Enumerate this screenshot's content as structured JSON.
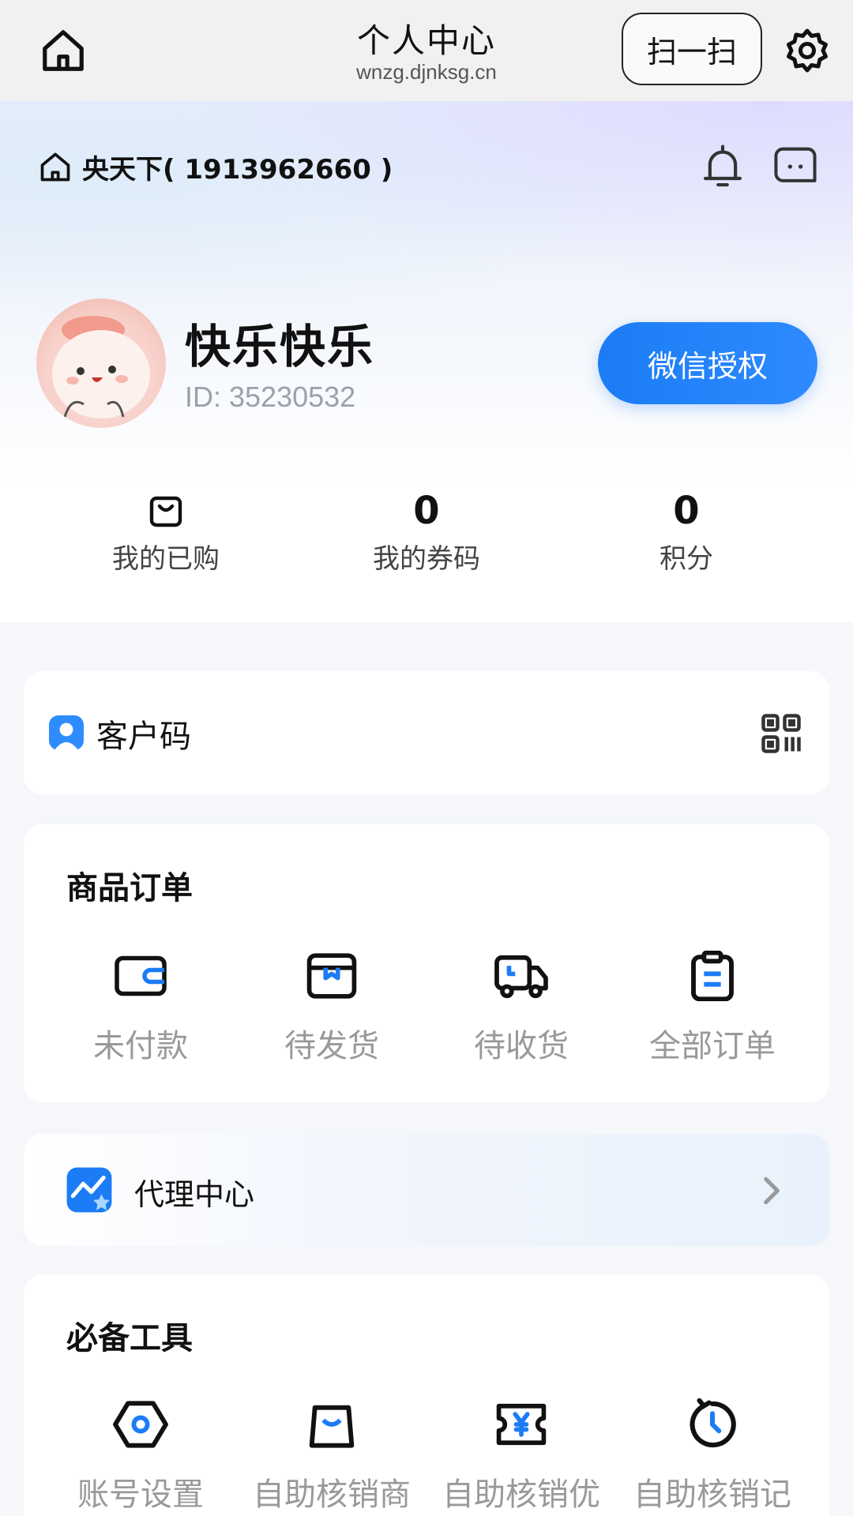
{
  "browser": {
    "title": "个人中心",
    "url": "wnzg.djnksg.cn",
    "scan_label": "扫一扫"
  },
  "header": {
    "store_name": "央天下( 1913962660 )"
  },
  "profile": {
    "name": "快乐快乐",
    "id_text": "ID: 35230532",
    "wechat_button": "微信授权"
  },
  "stats": [
    {
      "label": "我的已购",
      "icon": "shopping-bag-icon"
    },
    {
      "value": "0",
      "label": "我的券码"
    },
    {
      "value": "0",
      "label": "积分"
    }
  ],
  "customer_code": {
    "label": "客户码",
    "icon": "user-badge-icon",
    "action_icon": "qr-code-icon"
  },
  "orders": {
    "title": "商品订单",
    "items": [
      {
        "label": "未付款",
        "icon": "wallet-icon"
      },
      {
        "label": "待发货",
        "icon": "box-icon"
      },
      {
        "label": "待收货",
        "icon": "truck-icon"
      },
      {
        "label": "全部订单",
        "icon": "clipboard-icon"
      }
    ]
  },
  "agent": {
    "label": "代理中心",
    "icon": "chart-star-icon"
  },
  "tools": {
    "title": "必备工具",
    "items": [
      {
        "label": "账号设置",
        "icon": "hexagon-settings-icon"
      },
      {
        "label": "自助核销商",
        "icon": "bag-smile-icon"
      },
      {
        "label": "自助核销优",
        "icon": "coupon-yen-icon"
      },
      {
        "label": "自助核销记",
        "icon": "clock-history-icon"
      }
    ]
  },
  "colors": {
    "accent": "#1b7cf5",
    "muted_text": "#999999",
    "background": "#f5f7fa"
  }
}
